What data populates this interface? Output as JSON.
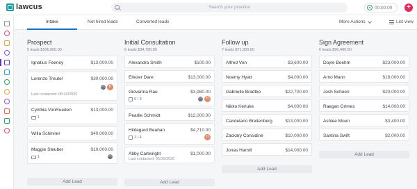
{
  "app": {
    "name": "lawcus",
    "search_placeholder": "Search your practice",
    "timer": "00:00:00",
    "add_icon": "+"
  },
  "sidebar": {
    "items": [
      "home-icon",
      "check-circle-icon",
      "folder-icon",
      "contact-icon",
      "briefcase-icon",
      "calendar-icon",
      "clock-icon",
      "dollar-icon",
      "billing-icon",
      "documents-icon",
      "transfer-icon",
      "phone-icon"
    ]
  },
  "tabs": {
    "items": [
      "Intake",
      "Not hired leads",
      "Converted leads"
    ],
    "active": "Intake",
    "more_actions": "More Actions",
    "list_view": "List view"
  },
  "columns": [
    {
      "title": "Prospect",
      "subtitle": "5 leads $106,000.00",
      "add_label": "Add Lead",
      "cards": [
        {
          "name": "Ignatius Feeney",
          "amount": "$13,000.00"
        },
        {
          "name": "Lorenzo Treutel",
          "amount": "$30,000.00",
          "last_contacted": "Last contacted: 05/10/2020",
          "avatars": [
            "photo",
            "H"
          ]
        },
        {
          "name": "Cynthia VonRueden",
          "amount": "$13,000.00",
          "comments": "1"
        },
        {
          "name": "Willa Schinner",
          "amount": "$40,000.00"
        },
        {
          "name": "Maggie Steuber",
          "amount": "$10,000.00",
          "comments": "1",
          "avatars": [
            "photo"
          ]
        }
      ]
    },
    {
      "title": "Initial Consultation",
      "subtitle": "6 leads $34,790.00",
      "add_label": "Add Lead",
      "cards": [
        {
          "name": "Alexandra Smith",
          "amount": "$100.00"
        },
        {
          "name": "Eliezer Dare",
          "amount": "$13,000.00"
        },
        {
          "name": "Giovanna Rau",
          "amount": "$3,980.00",
          "tasks": "0 / 3",
          "avatars": [
            "photo",
            "H"
          ]
        },
        {
          "name": "Pearlie Schmidt",
          "amount": "$12,000.00"
        },
        {
          "name": "Hildegard Beahan",
          "amount": "$4,710.00",
          "tasks": "2 / 4",
          "avatars": [
            "H"
          ]
        },
        {
          "name": "Abby Cartwright",
          "amount": "$1,000.00",
          "last_contacted": "Last contacted: 05/10/2020"
        }
      ]
    },
    {
      "title": "Follow up",
      "subtitle": "7 leads $71,300.00",
      "add_label": "Add Lead",
      "cards": [
        {
          "name": "Alfred Von",
          "amount": "$3,600.00"
        },
        {
          "name": "Noemy Hyatt",
          "amount": "$4,000.00"
        },
        {
          "name": "Gabrielle Bradtke",
          "amount": "$22,700.00"
        },
        {
          "name": "Nikko Kerluke",
          "amount": "$4,000.00"
        },
        {
          "name": "Candelario Breitenberg",
          "amount": "$13,000.00"
        },
        {
          "name": "Zackary Considine",
          "amount": "$10,000.00"
        },
        {
          "name": "Jonas Hamill",
          "amount": "$14,000.00"
        }
      ]
    },
    {
      "title": "Sign Agreement",
      "subtitle": "6 leads $90,400.00",
      "add_label": "Add Lead",
      "cards": [
        {
          "name": "Doyle Boehm",
          "amount": "$23,000.00"
        },
        {
          "name": "Arno Mann",
          "amount": "$18,000.00"
        },
        {
          "name": "Josh Schoen",
          "amount": "$20,000.00"
        },
        {
          "name": "Raegan Grimes",
          "amount": "$14,000.00"
        },
        {
          "name": "Ashlee Moen",
          "amount": "$3,400.00"
        },
        {
          "name": "Santina Swift",
          "amount": "$2,000.00"
        }
      ]
    }
  ]
}
